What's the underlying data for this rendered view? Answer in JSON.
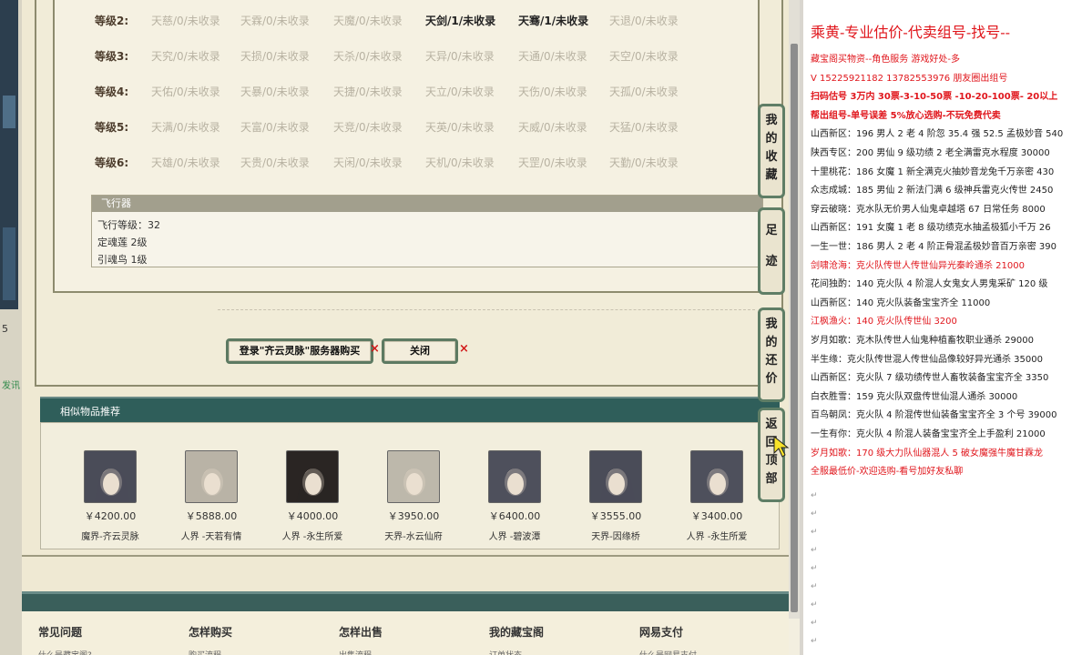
{
  "left_strip": {
    "num": "5",
    "fa": "发讯"
  },
  "levels": [
    {
      "label": "等级2:",
      "cells": [
        "天慈/0/未收录",
        "天霖/0/未收录",
        "天魔/0/未收录",
        "天剑/1/未收录",
        "天骞/1/未收录",
        "天退/0/未收录"
      ],
      "on": [
        false,
        false,
        false,
        true,
        true,
        false
      ]
    },
    {
      "label": "等级3:",
      "cells": [
        "天究/0/未收录",
        "天损/0/未收录",
        "天杀/0/未收录",
        "天异/0/未收录",
        "天通/0/未收录",
        "天空/0/未收录"
      ],
      "on": [
        false,
        false,
        false,
        false,
        false,
        false
      ]
    },
    {
      "label": "等级4:",
      "cells": [
        "天佑/0/未收录",
        "天暴/0/未收录",
        "天捷/0/未收录",
        "天立/0/未收录",
        "天伤/0/未收录",
        "天孤/0/未收录"
      ],
      "on": [
        false,
        false,
        false,
        false,
        false,
        false
      ]
    },
    {
      "label": "等级5:",
      "cells": [
        "天满/0/未收录",
        "天富/0/未收录",
        "天竞/0/未收录",
        "天英/0/未收录",
        "天威/0/未收录",
        "天猛/0/未收录"
      ],
      "on": [
        false,
        false,
        false,
        false,
        false,
        false
      ]
    },
    {
      "label": "等级6:",
      "cells": [
        "天雄/0/未收录",
        "天贵/0/未收录",
        "天闲/0/未收录",
        "天机/0/未收录",
        "天罡/0/未收录",
        "天勤/0/未收录"
      ],
      "on": [
        false,
        false,
        false,
        false,
        false,
        false
      ]
    }
  ],
  "fly": {
    "header": "飞行器",
    "lines": [
      "飞行等级：32",
      "定魂莲   2级",
      "引魂鸟   1级"
    ]
  },
  "buttons": {
    "login": "登录\"齐云灵脉\"服务器购买",
    "close": "关闭",
    "x": "×"
  },
  "recommend": {
    "title": "相似物品推荐",
    "items": [
      {
        "price": "￥4200.00",
        "name": "魔界-齐云灵脉"
      },
      {
        "price": "￥5888.00",
        "name": "人界 -天若有情"
      },
      {
        "price": "￥4000.00",
        "name": "人界 -永生所爱"
      },
      {
        "price": "￥3950.00",
        "name": "天界-水云仙府"
      },
      {
        "price": "￥6400.00",
        "name": "人界 -碧波潭"
      },
      {
        "price": "￥3555.00",
        "name": "天界-因缘桥"
      },
      {
        "price": "￥3400.00",
        "name": "人界 -永生所爱"
      }
    ]
  },
  "footer": {
    "cols": [
      {
        "title": "常见问题",
        "sub": "什么是藏宝阁?"
      },
      {
        "title": "怎样购买",
        "sub": "购买流程"
      },
      {
        "title": "怎样出售",
        "sub": "出售流程"
      },
      {
        "title": "我的藏宝阁",
        "sub": "订单状态"
      },
      {
        "title": "网易支付",
        "sub": "什么是网易支付"
      }
    ]
  },
  "float_nav": [
    {
      "label": "我的收藏"
    },
    {
      "label": "足迹"
    },
    {
      "label": "我的还价"
    },
    {
      "label": "返回顶部"
    }
  ],
  "chat": {
    "title": "乘黄-专业估价-代卖组号-找号--",
    "lines": [
      {
        "t": "藏宝阁买物资--角色服务 游戏好处-多",
        "red": true,
        "bold": false
      },
      {
        "t": "V 15225921182   13782553976 朋友圈出组号",
        "red": true,
        "bold": false
      },
      {
        "t": "扫码估号 3万内 30票-3-10-50票 -10-20-100票- 20以上",
        "red": true,
        "bold": true
      },
      {
        "t": "帮出组号-单号误差 5%放心选购-不玩免费代卖",
        "red": true,
        "bold": true
      },
      {
        "t": "山西新区：196 男人 2 老 4 阶忽 35.4 强 52.5 孟极妙音 540",
        "red": false,
        "bold": false
      },
      {
        "t": "陕西专区：200 男仙 9 级功绩 2 老全满雷克水程度 30000",
        "red": false,
        "bold": false
      },
      {
        "t": "十里桃花：186 女魔 1 新全满克火抽妙音龙兔千万亲密 430",
        "red": false,
        "bold": false
      },
      {
        "t": "众志成城：185 男仙 2 新法门满 6 级神兵雷克火传世 2450",
        "red": false,
        "bold": false
      },
      {
        "t": "穿云破晓：克水队无价男人仙鬼卓越塔 67 日常任务 8000",
        "red": false,
        "bold": false
      },
      {
        "t": "山西新区：191 女魔 1 老 8 级功绩克水抽孟极狐小千万 26",
        "red": false,
        "bold": false
      },
      {
        "t": "一生一世：186 男人 2 老 4 阶正骨混孟极妙音百万亲密 390",
        "red": false,
        "bold": false
      },
      {
        "t": "剑啸沧海：克火队传世人传世仙异光秦岭通杀 21000",
        "red": true,
        "bold": false
      },
      {
        "t": "花间独酌：140 克火队 4 阶混人女鬼女人男鬼采矿 120 级",
        "red": false,
        "bold": false
      },
      {
        "t": "山西新区：140 克火队装备宝宝齐全 11000",
        "red": false,
        "bold": false
      },
      {
        "t": "江枫渔火：140 克火队传世仙 3200",
        "red": true,
        "bold": false
      },
      {
        "t": "岁月如歌：克木队传世人仙鬼种植畜牧职业通杀 29000",
        "red": false,
        "bold": false
      },
      {
        "t": "半生缘：克火队传世混人传世仙品像较好异光通杀 35000",
        "red": false,
        "bold": false
      },
      {
        "t": "山西新区：克火队 7 级功绩传世人畜牧装备宝宝齐全 3350",
        "red": false,
        "bold": false
      },
      {
        "t": "白衣胜雪：159 克火队双盘传世仙混人通杀 30000",
        "red": false,
        "bold": false
      },
      {
        "t": "百鸟朝凤：克火队 4 阶混传世仙装备宝宝齐全 3 个号 39000",
        "red": false,
        "bold": false
      },
      {
        "t": "一生有你：克火队 4 阶混人装备宝宝齐全上手盈利 21000",
        "red": false,
        "bold": false
      },
      {
        "t": "岁月如歌：170 级大力队仙器混人 5 破女魔强牛魔甘霖龙",
        "red": true,
        "bold": false
      },
      {
        "t": "全服最低价-欢迎选购-看号加好友私聊",
        "red": true,
        "bold": false
      }
    ],
    "enter": "↵"
  },
  "colors": {
    "teal": "#2f5e5a",
    "red": "#e0161c",
    "frame": "#8d8b6e"
  }
}
